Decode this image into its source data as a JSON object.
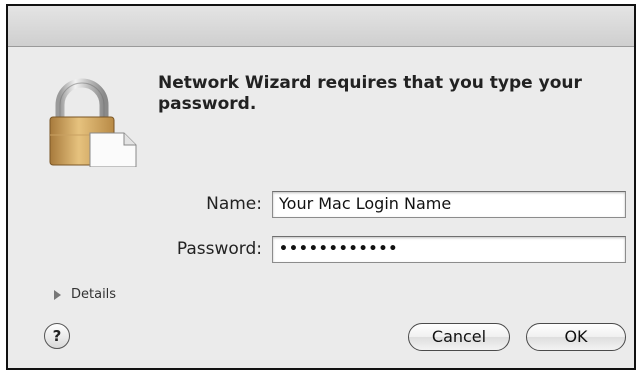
{
  "dialog": {
    "message": "Network Wizard requires that you type your password.",
    "fields": {
      "name_label": "Name:",
      "name_value": "Your Mac Login Name",
      "password_label": "Password:",
      "password_value": "••••••••••••"
    },
    "details_label": "Details",
    "help_label": "?",
    "buttons": {
      "cancel": "Cancel",
      "ok": "OK"
    }
  }
}
